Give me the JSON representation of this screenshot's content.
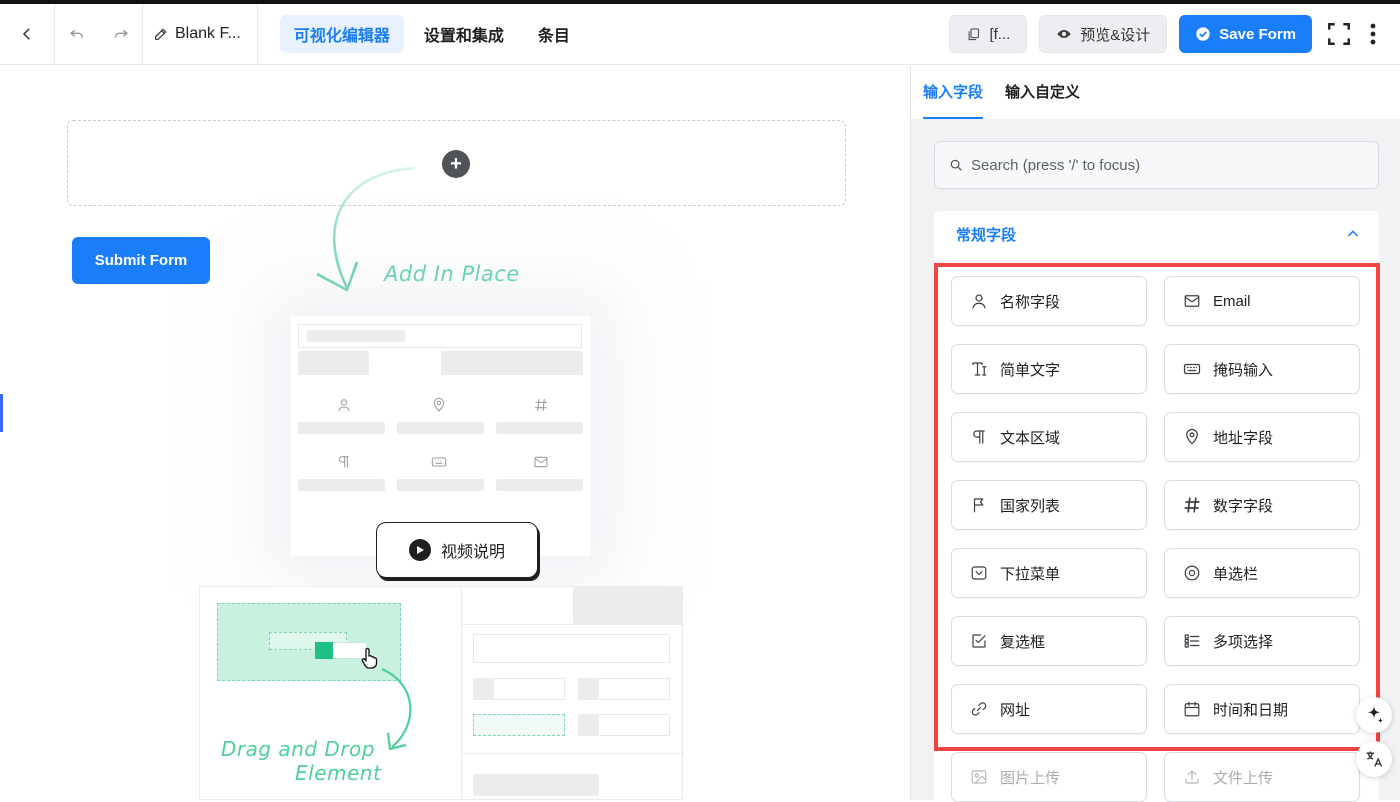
{
  "header": {
    "form_title": "Blank F...",
    "tabs": [
      "可视化编辑器",
      "设置和集成",
      "条目"
    ],
    "shortcode_label": "[f...",
    "preview_label": "预览&设计",
    "save_label": "Save Form"
  },
  "canvas": {
    "submit_label": "Submit Form",
    "add_in_place": "Add In Place",
    "video_label": "视频说明",
    "drag_drop_line1": "Drag and Drop",
    "drag_drop_line2": "Element"
  },
  "sidebar": {
    "tabs": [
      "输入字段",
      "输入自定义"
    ],
    "search_placeholder": "Search (press '/' to focus)",
    "section_title": "常规字段",
    "fields": [
      {
        "label": "名称字段",
        "icon": "user-icon"
      },
      {
        "label": "Email",
        "icon": "envelope-icon"
      },
      {
        "label": "简单文字",
        "icon": "text-icon"
      },
      {
        "label": "掩码输入",
        "icon": "keyboard-icon"
      },
      {
        "label": "文本区域",
        "icon": "paragraph-icon"
      },
      {
        "label": "地址字段",
        "icon": "map-pin-icon"
      },
      {
        "label": "国家列表",
        "icon": "flag-icon"
      },
      {
        "label": "数字字段",
        "icon": "hash-icon"
      },
      {
        "label": "下拉菜单",
        "icon": "dropdown-icon"
      },
      {
        "label": "单选栏",
        "icon": "radio-icon"
      },
      {
        "label": "复选框",
        "icon": "checkbox-icon"
      },
      {
        "label": "多项选择",
        "icon": "list-icon"
      },
      {
        "label": "网址",
        "icon": "link-icon"
      },
      {
        "label": "时间和日期",
        "icon": "calendar-icon"
      },
      {
        "label": "图片上传",
        "icon": "image-upload-icon"
      },
      {
        "label": "文件上传",
        "icon": "file-upload-icon"
      }
    ]
  },
  "colors": {
    "primary": "#1a7efb",
    "highlight_box": "#f04445",
    "accent_green": "#4fcf9a"
  }
}
